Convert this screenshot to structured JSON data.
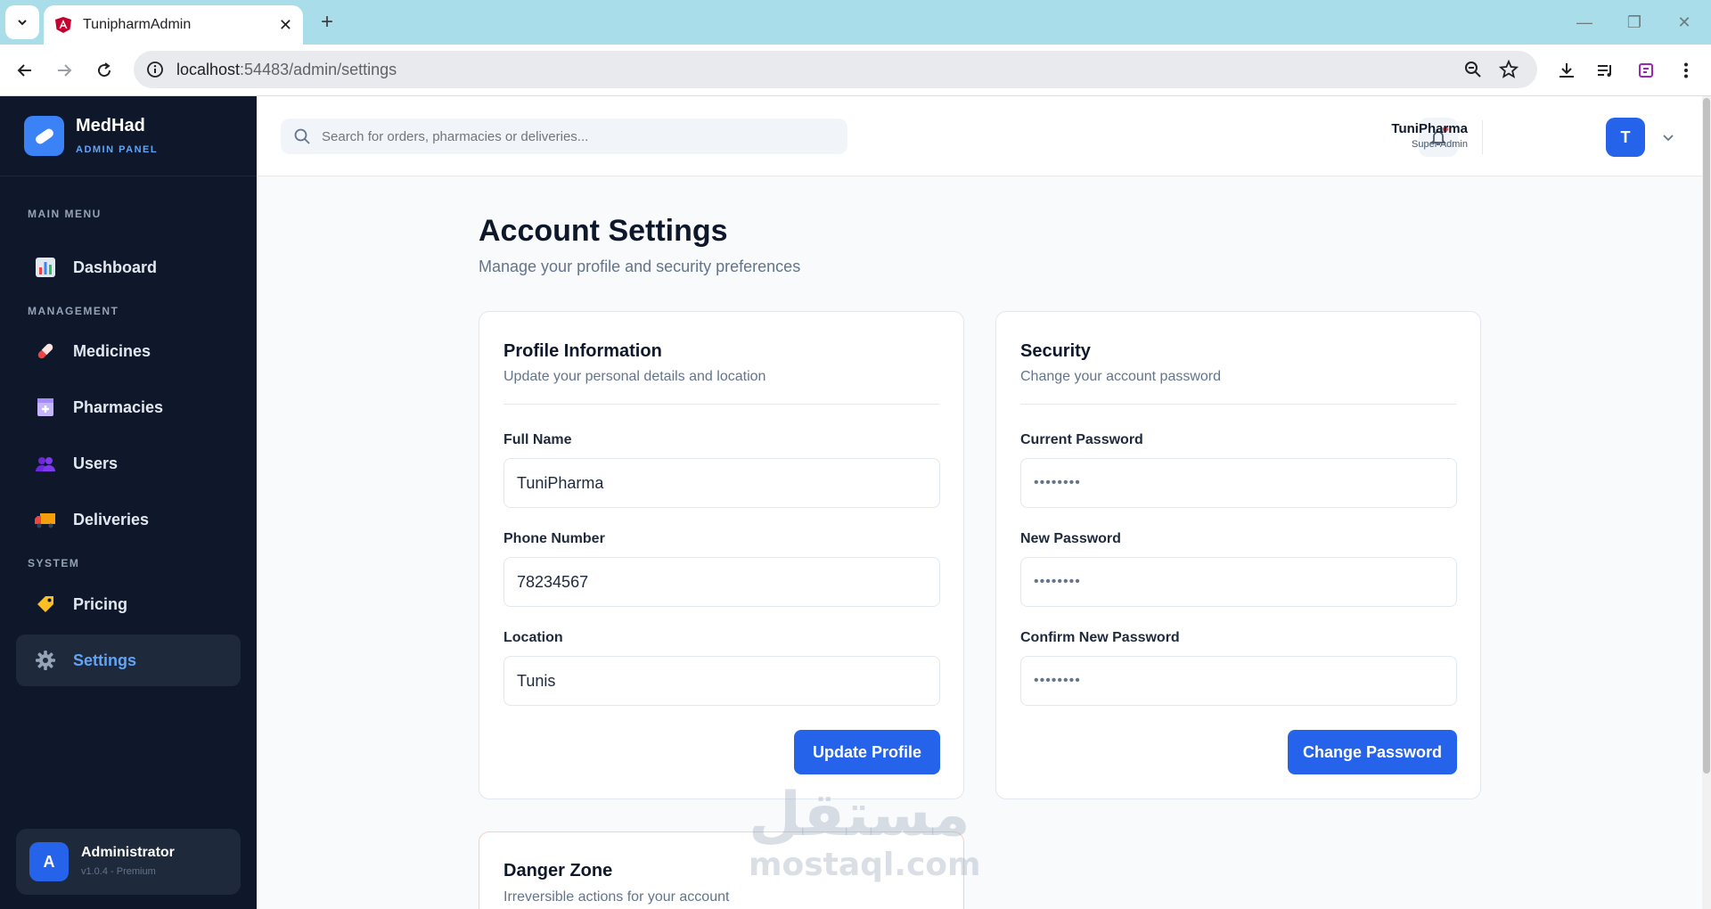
{
  "browser": {
    "tab_title": "TunipharmAdmin",
    "url_host": "localhost",
    "url_path": ":54483/admin/settings"
  },
  "sidebar": {
    "brand_name": "MedHad",
    "brand_sub": "ADMIN PANEL",
    "sections": {
      "main": "MAIN MENU",
      "management": "MANAGEMENT",
      "system": "SYSTEM"
    },
    "items": [
      {
        "label": "Dashboard",
        "icon": "bar-chart-icon"
      },
      {
        "label": "Medicines",
        "icon": "pill-icon"
      },
      {
        "label": "Pharmacies",
        "icon": "pharmacy-icon"
      },
      {
        "label": "Users",
        "icon": "users-icon"
      },
      {
        "label": "Deliveries",
        "icon": "truck-icon"
      },
      {
        "label": "Pricing",
        "icon": "tag-icon"
      },
      {
        "label": "Settings",
        "icon": "gear-icon",
        "active": true
      }
    ],
    "user": {
      "avatar": "A",
      "name": "Administrator",
      "version": "v1.0.4 - Premium"
    }
  },
  "header": {
    "search_placeholder": "Search for orders, pharmacies or deliveries...",
    "user_name": "TuniPharma",
    "user_role": "Super Admin",
    "avatar": "T"
  },
  "main": {
    "title": "Account Settings",
    "subtitle": "Manage your profile and security preferences",
    "profile": {
      "title": "Profile Information",
      "subtitle": "Update your personal details and location",
      "full_name_label": "Full Name",
      "full_name_value": "TuniPharma",
      "phone_label": "Phone Number",
      "phone_value": "78234567",
      "location_label": "Location",
      "location_value": "Tunis",
      "button": "Update Profile"
    },
    "security": {
      "title": "Security",
      "subtitle": "Change your account password",
      "current_label": "Current Password",
      "current_value": "••••••••",
      "new_label": "New Password",
      "new_value": "••••••••",
      "confirm_label": "Confirm New Password",
      "confirm_value": "••••••••",
      "button": "Change Password"
    },
    "danger": {
      "title": "Danger Zone",
      "subtitle": "Irreversible actions for your account"
    }
  },
  "watermark": {
    "arabic": "مستقل",
    "latin": "mostaql.com"
  },
  "colors": {
    "sidebar_bg": "#0f172a",
    "accent": "#2563eb",
    "active_text": "#60a5fa"
  }
}
